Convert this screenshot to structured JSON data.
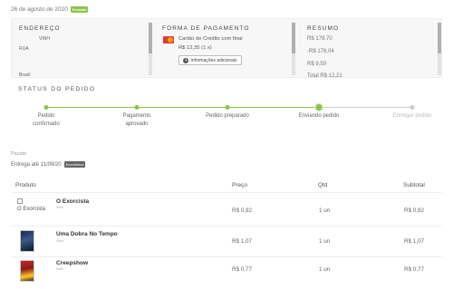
{
  "order": {
    "date": "26 de agosto de 2020",
    "status_badge": "Enviado",
    "colors": {
      "accent_green": "#8bc34a",
      "pending_gray": "#cccccc"
    }
  },
  "address": {
    "title": "ENDEREÇO",
    "lines": [
      "VINH",
      "RUA",
      "",
      "Brasil"
    ]
  },
  "payment": {
    "title": "FORMA DE PAGAMENTO",
    "card_icon": "mastercard-icon",
    "method": "Cartão de Crédito com final",
    "installment": "R$ 12,35 (1 x)",
    "info_button": "Informações adicionais"
  },
  "summary": {
    "title": "RESUMO",
    "lines": [
      "R$ 179,70",
      "-R$ 176,04",
      "R$ 9,59",
      "Total                    R$ 12,21"
    ]
  },
  "status": {
    "title": "STATUS DO PEDIDO",
    "steps": [
      {
        "label": "Pedido confirmado",
        "state": "done"
      },
      {
        "label": "Pagamento aprovado",
        "state": "done"
      },
      {
        "label": "Pedido preparado",
        "state": "done"
      },
      {
        "label": "Enviando pedido",
        "state": "current"
      },
      {
        "label": "Entregar pedido",
        "state": "pending"
      }
    ]
  },
  "package": {
    "label": "Pacote",
    "delivery": "Entrega até 11/09/20",
    "shipping_badge": "Econômica"
  },
  "table": {
    "headers": {
      "product": "Produto",
      "price": "Preço",
      "qty": "Qtd",
      "subtotal": "Subtotal"
    },
    "rows": [
      {
        "image_alt": "O Exorcista",
        "name": "O Exorcista",
        "subtitle": "Série",
        "price": "R$ 0,92",
        "qty": "1 un",
        "subtotal": "R$ 0,92"
      },
      {
        "image_alt": "",
        "name": "Uma Dobra No Tempo",
        "subtitle": "Série",
        "price": "R$ 1,07",
        "qty": "1 un",
        "subtotal": "R$ 1,07"
      },
      {
        "image_alt": "",
        "name": "Creepshow",
        "subtitle": "Série",
        "price": "R$ 0,77",
        "qty": "1 un",
        "subtotal": "R$ 0,77"
      }
    ]
  }
}
